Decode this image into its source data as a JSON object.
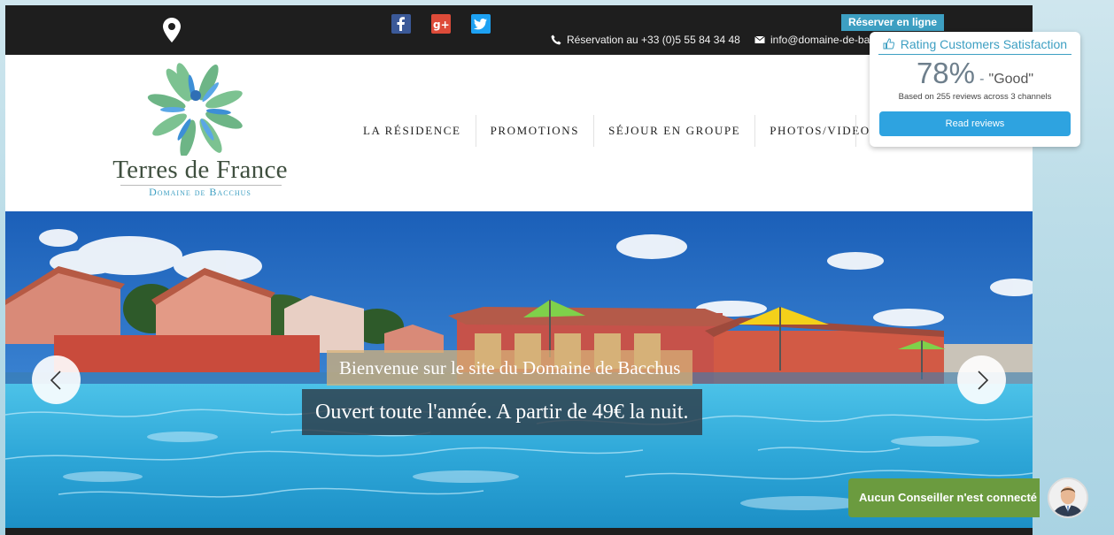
{
  "topbar": {
    "reserve_label": "Réserver en ligne",
    "phone": "Réservation au +33 (0)5 55 84 34 48",
    "email": "info@domaine-de-bacchus.com",
    "icons": [
      "map-pin-icon",
      "facebook-icon",
      "google-plus-icon",
      "twitter-icon",
      "phone-icon",
      "mail-icon"
    ],
    "colors": {
      "bar": "#1e1e1e",
      "accent": "#3d9fc2",
      "facebook": "#3b5998",
      "google_plus": "#dd4b39",
      "twitter": "#1da1f2"
    }
  },
  "logo": {
    "title": "Terres de France",
    "subtitle": "Domaine de Bacchus"
  },
  "nav": {
    "items": [
      {
        "label": "LA RÉSIDENCE"
      },
      {
        "label": "PROMOTIONS"
      },
      {
        "label": "SÉJOUR EN GROUPE"
      },
      {
        "label": "PHOTOS/VIDEO"
      }
    ]
  },
  "hero": {
    "caption_line1": "Bienvenue sur le site du Domaine de Bacchus",
    "caption_line2": "Ouvert toute l'année. A partir de 49€ la nuit."
  },
  "rating": {
    "title": "Rating Customers Satisfaction",
    "score": "78%",
    "separator": "-",
    "verdict": "\"Good\"",
    "based_on": "Based on 255 reviews across 3 channels",
    "button_label": "Read reviews"
  },
  "chat": {
    "label": "Aucun Conseiller n'est connecté"
  }
}
